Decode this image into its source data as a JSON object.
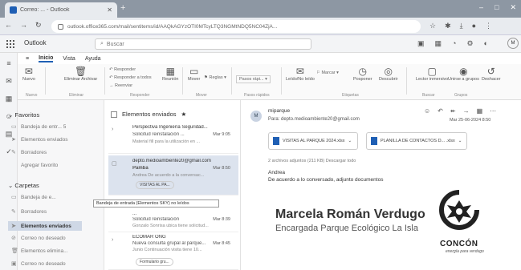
{
  "browser": {
    "tab_title": "Correo: ... - Outlook",
    "url": "outlook.office365.com/mail/sentitems/id/AAQkAGYzOTI0MTcyLTQ3NGMtNDQ5NC04ZjA...",
    "new_tab": "+",
    "win_min": "–",
    "win_max": "□",
    "win_close": "✕"
  },
  "outlook": {
    "brand": "Outlook",
    "search_placeholder": "Buscar"
  },
  "ribbon": {
    "tabs": [
      "Inicio",
      "Vista",
      "Ayuda"
    ],
    "buttons": {
      "new": "Nuevo",
      "delete": "Eliminar Archivar",
      "reply": "Responder",
      "reply_all": "Responder a todos",
      "forward": "Reenviar",
      "meeting": "Reunión",
      "move": "Mover",
      "rules": "Reglas",
      "quick": "Pasos rápi...",
      "read": "Leído/No leído",
      "flag": "Marcar",
      "snooze": "Posponer",
      "discover": "Descubrir",
      "immersive": "Lector inmersivo",
      "groups": "Unirse a grupos",
      "undo": "Deshacer"
    },
    "groups": [
      "Nuevo",
      "Eliminar",
      "Responder",
      "Mover",
      "Pasos rápidos",
      "Etiquetas",
      "Buscar",
      "Grupos"
    ]
  },
  "folders": {
    "favorites_header": "Favoritos",
    "favorites": [
      {
        "icon": "folder",
        "label": "Bandeja de entr... 5"
      },
      {
        "icon": "send",
        "label": "Elementos enviados"
      },
      {
        "icon": "draft",
        "label": "Borradores"
      },
      {
        "icon": "",
        "label": "Agregar favorito"
      }
    ],
    "folders_header": "Carpetas",
    "folders": [
      {
        "icon": "folder",
        "label": "Bandeja de e..."
      },
      {
        "icon": "draft",
        "label": "Borradores"
      },
      {
        "icon": "send",
        "label": "Elementos enviados"
      },
      {
        "icon": "junk",
        "label": "Correo no deseado"
      },
      {
        "icon": "trash",
        "label": "Elementos elimina..."
      },
      {
        "icon": "archive",
        "label": "Correo no deseado"
      }
    ],
    "tooltip": "Bandeja de entrada (Elementos SKY) no leídos"
  },
  "list": {
    "header": "Elementos enviados",
    "messages": [
      {
        "to": "Perspectiva Ingeniería Seguridad...",
        "subject": "Solicitud reinstalación ...",
        "preview": "Material fill para la utilización en ...",
        "date": "Mar 9:05"
      },
      {
        "to": "depto.medioambiente20@gmail.com",
        "subject": "Pamba",
        "preview": "Andrea De acuerdo a la conversac...",
        "date": "Mar 8:50",
        "attachment": "VISITAS AL PA..."
      },
      {
        "to": "...",
        "subject": "Solicitud reinstalación",
        "preview": "Gonzalo Sonrisa ubica tiene solicitud...",
        "date": "Mar 8:39"
      },
      {
        "to": "ECOMAR ONG",
        "subject": "Nueva consulta grupal al parque...",
        "preview": "Junio Continuación visita tiene 10...",
        "date": "Mar 8:45",
        "attachment": "Formulario gru..."
      }
    ]
  },
  "reading": {
    "from": "miparque",
    "to": "Para: depto.medioambiente20@gmail.com",
    "date": "Mar 25-06-2024 8:50",
    "attachments": [
      "VISITAS AL PARQUE 2024.xlsx",
      "PLANILLA DE CONTACTOS D... .xlsx"
    ],
    "attachments_line": "2 archivos adjuntos (211 KB)   Descargar todo",
    "greeting": "Andrea",
    "body": "De acuerdo a lo conversado, adjunto documentos",
    "signature_name": "Marcela Román Verdugo",
    "signature_role": "Encargada Parque Ecológico La Isla",
    "logo_name": "CONCÓN",
    "logo_tagline": "energía para verdugo",
    "avatar_initial": "M"
  },
  "colors": {
    "accent": "#1f5fb4",
    "selected": "#cfd8e6"
  }
}
